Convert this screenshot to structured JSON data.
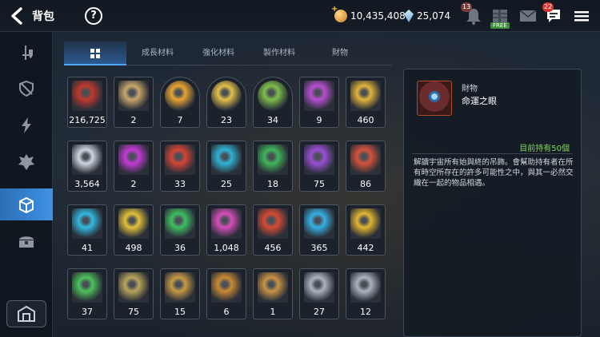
{
  "header": {
    "title": "背包",
    "help_label": "?",
    "gold_amount": "10,435,408",
    "gem_amount": "25,074",
    "bell_badge": "13",
    "free_label": "FREE",
    "chat_badge": "22"
  },
  "tabs": [
    "成長材料",
    "強化材料",
    "製作材料",
    "財物"
  ],
  "items": [
    {
      "qty": "216,725",
      "icon": "red-crest-icon",
      "color": "#c0392b"
    },
    {
      "qty": "2",
      "icon": "ticket-icon",
      "color": "#c9a66b"
    },
    {
      "qty": "7",
      "icon": "hamster-orange-icon",
      "color": "#e8a531"
    },
    {
      "qty": "23",
      "icon": "hamster-yellow-icon",
      "color": "#e3c04a"
    },
    {
      "qty": "34",
      "icon": "hamster-green-icon",
      "color": "#7cbf4a"
    },
    {
      "qty": "9",
      "icon": "purple-flower-icon",
      "color": "#b84fd1"
    },
    {
      "qty": "460",
      "icon": "gold-flower-icon",
      "color": "#e3b43a"
    },
    {
      "qty": "3,564",
      "icon": "silver-flower-icon",
      "color": "#cfd6df"
    },
    {
      "qty": "2",
      "icon": "purple-pentagon-gem-icon",
      "color": "#c43bd6"
    },
    {
      "qty": "33",
      "icon": "red-hexagon-gem-icon",
      "color": "#d44536"
    },
    {
      "qty": "25",
      "icon": "blue-hexagon-gem-icon",
      "color": "#2fb3d6"
    },
    {
      "qty": "18",
      "icon": "green-hexagon-gem-icon",
      "color": "#3fb65a"
    },
    {
      "qty": "75",
      "icon": "purple-triangle-gem-icon",
      "color": "#9b4fd6"
    },
    {
      "qty": "86",
      "icon": "red-triangle-gem-icon",
      "color": "#d6523c"
    },
    {
      "qty": "41",
      "icon": "blue-triangle-gem-icon",
      "color": "#33b9e0"
    },
    {
      "qty": "498",
      "icon": "yellow-triangle-gem-icon",
      "color": "#e3c23a"
    },
    {
      "qty": "36",
      "icon": "green-triangle-gem-icon",
      "color": "#3fbf63"
    },
    {
      "qty": "1,048",
      "icon": "pink-oval-gem-icon",
      "color": "#d64fb9"
    },
    {
      "qty": "456",
      "icon": "red-oval-gem-icon",
      "color": "#d64b36"
    },
    {
      "qty": "365",
      "icon": "blue-oval-gem-icon",
      "color": "#36b0e3"
    },
    {
      "qty": "442",
      "icon": "gold-oval-gem-icon",
      "color": "#e3b531"
    },
    {
      "qty": "37",
      "icon": "green-oval-gem-icon",
      "color": "#4cc35a"
    },
    {
      "qty": "75",
      "icon": "feather-icon",
      "color": "#b8a55a"
    },
    {
      "qty": "15",
      "icon": "crossed-swords-emblem-icon",
      "color": "#c79a45"
    },
    {
      "qty": "6",
      "icon": "spider-emblem-icon",
      "color": "#c98a35"
    },
    {
      "qty": "1",
      "icon": "bow-emblem-icon",
      "color": "#c99345"
    },
    {
      "qty": "27",
      "icon": "silver-swords-emblem-icon",
      "color": "#aab4bf"
    },
    {
      "qty": "12",
      "icon": "silver-shield-emblem-icon",
      "color": "#aab4bf"
    }
  ],
  "detail": {
    "category": "財物",
    "name": "命運之眼",
    "owned": "目前持有50個",
    "description": "解讀宇宙所有始與終的吊飾。會幫助持有者在所有時空所存在的許多可能性之中，與其一必然交織在一起的物品相遇。",
    "icon": "eye-of-fate-icon"
  }
}
